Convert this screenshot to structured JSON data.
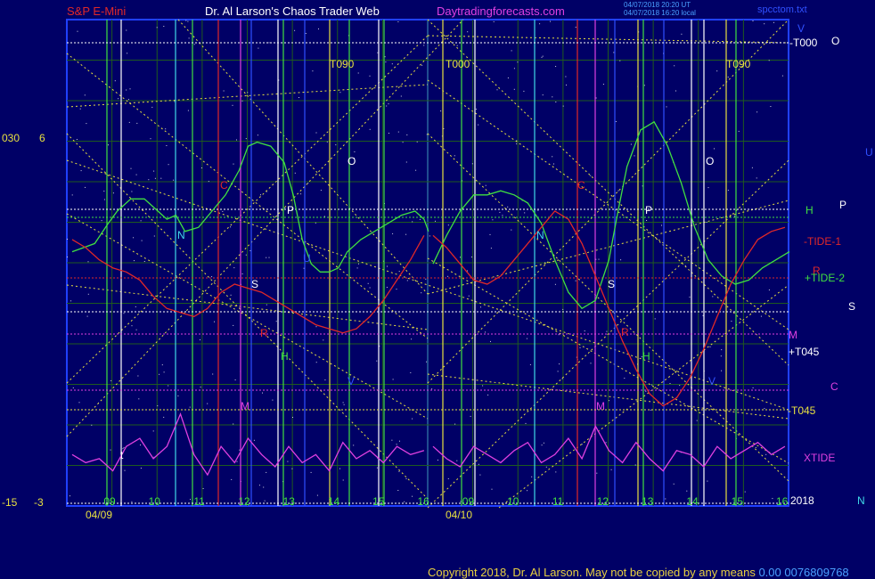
{
  "header": {
    "symbol": "S&P E-Mini",
    "site_title": "Dr. Al Larson's Chaos Trader Web",
    "url": "Daytradingforecasts.com",
    "timestamp1": "04/07/2018 20:20 UT",
    "timestamp2": "04/07/2018 16:20 local",
    "file": "spcctom.txt"
  },
  "footer": {
    "copyright": "Copyright 2018, Dr. Al Larson. May not be copied by any means",
    "tail": "0.00 0076809768"
  },
  "colors": {
    "background": "#000066",
    "grid_green": "#1f5a1f",
    "yellow": "#e8e040",
    "green": "#40e040",
    "red": "#e02828",
    "magenta": "#e040e0",
    "cyan": "#40d8e8",
    "white": "#ffffff",
    "blue": "#3050ff"
  },
  "chart_data": {
    "type": "line",
    "title": "S&P E-Mini",
    "y_left_labels": [
      {
        "label": "030",
        "value": 6
      },
      {
        "label": "6",
        "value": 6
      },
      {
        "label": "-15",
        "value": -3
      },
      {
        "label": "-3",
        "value": -3
      }
    ],
    "ylim": [
      -3,
      6
    ],
    "x_hour_ticks": [
      "09",
      "10",
      "11",
      "12",
      "13",
      "14",
      "15",
      "16",
      "09",
      "10",
      "11",
      "12",
      "13",
      "14",
      "15",
      "16"
    ],
    "x_dates": [
      "04/09",
      "04/10"
    ],
    "right_labels": [
      {
        "text": "V",
        "color": "#3050ff"
      },
      {
        "text": "-T000",
        "color": "#ffffff"
      },
      {
        "text": "O",
        "color": "#ffffff"
      },
      {
        "text": "U",
        "color": "#3050ff"
      },
      {
        "text": "H",
        "color": "#40e040"
      },
      {
        "text": "P",
        "color": "#ffffff"
      },
      {
        "text": "-TIDE-1",
        "color": "#e02828"
      },
      {
        "text": "R",
        "color": "#e02828"
      },
      {
        "text": "+TIDE-2",
        "color": "#40e040"
      },
      {
        "text": "S",
        "color": "#ffffff"
      },
      {
        "text": "M",
        "color": "#e040e0"
      },
      {
        "text": "+T045",
        "color": "#ffffff"
      },
      {
        "text": "C",
        "color": "#e040e0"
      },
      {
        "text": "-T045",
        "color": "#e8e040"
      },
      {
        "text": "XTIDE",
        "color": "#e040e0"
      },
      {
        "text": "2018",
        "color": "#ffffff"
      },
      {
        "text": "N",
        "color": "#40d8e8"
      }
    ],
    "marker_labels": [
      {
        "text": "T090",
        "color": "#e8e040"
      },
      {
        "text": "T000",
        "color": "#e8e040"
      },
      {
        "text": "T090",
        "color": "#e8e040"
      },
      {
        "text": "C",
        "color": "#e02828"
      },
      {
        "text": "N",
        "color": "#40d8e8"
      },
      {
        "text": "P",
        "color": "#ffffff"
      },
      {
        "text": "O",
        "color": "#ffffff"
      },
      {
        "text": "S",
        "color": "#ffffff"
      },
      {
        "text": "R",
        "color": "#e02828"
      },
      {
        "text": "H",
        "color": "#40e040"
      },
      {
        "text": "M",
        "color": "#e040e0"
      },
      {
        "text": "V",
        "color": "#3050ff"
      },
      {
        "text": "U",
        "color": "#3050ff"
      },
      {
        "text": "C",
        "color": "#e02828"
      },
      {
        "text": "N",
        "color": "#40d8e8"
      },
      {
        "text": "P",
        "color": "#ffffff"
      },
      {
        "text": "O",
        "color": "#ffffff"
      },
      {
        "text": "S",
        "color": "#ffffff"
      },
      {
        "text": "R",
        "color": "#e02828"
      },
      {
        "text": "H",
        "color": "#40e040"
      },
      {
        "text": "M",
        "color": "#e040e0"
      },
      {
        "text": "V",
        "color": "#3050ff"
      },
      {
        "text": "t",
        "color": "#ffffff"
      }
    ],
    "series": [
      {
        "name": "+TIDE-2",
        "color": "#40e040",
        "x": [
          9.0,
          9.5,
          9.8,
          10.0,
          10.3,
          10.6,
          10.9,
          11.1,
          11.3,
          11.5,
          11.8,
          12.1,
          12.4,
          12.7,
          12.9,
          13.1,
          13.4,
          13.7,
          13.9,
          14.1,
          14.3,
          14.5,
          14.7,
          14.9,
          15.1,
          15.4,
          15.7,
          16.0,
          16.3,
          16.6,
          16.8,
          16.9
        ],
        "values": [
          3.2,
          3.4,
          3.9,
          4.2,
          4.5,
          4.5,
          4.2,
          4.0,
          4.1,
          3.7,
          3.8,
          4.2,
          4.6,
          5.2,
          5.8,
          5.9,
          5.8,
          5.4,
          4.6,
          3.5,
          2.9,
          2.7,
          2.7,
          2.8,
          3.2,
          3.5,
          3.7,
          3.9,
          4.1,
          4.2,
          4.0,
          3.7
        ]
      },
      {
        "name": "+TIDE-2 (04/10)",
        "color": "#40e040",
        "x": [
          9.0,
          9.3,
          9.6,
          9.9,
          10.2,
          10.5,
          10.8,
          11.1,
          11.4,
          11.7,
          12.0,
          12.3,
          12.6,
          12.9,
          13.1,
          13.3,
          13.6,
          13.9,
          14.2,
          14.5,
          14.8,
          15.1,
          15.4,
          15.7,
          16.0,
          16.3,
          16.6,
          16.9
        ],
        "values": [
          2.9,
          3.6,
          4.2,
          4.6,
          4.6,
          4.7,
          4.6,
          4.4,
          3.9,
          3.0,
          2.2,
          1.8,
          2.0,
          3.0,
          4.2,
          5.3,
          6.2,
          6.4,
          5.8,
          4.9,
          3.8,
          3.0,
          2.6,
          2.4,
          2.5,
          2.8,
          3.0,
          3.2
        ]
      },
      {
        "name": "-TIDE-1",
        "color": "#e02828",
        "x": [
          9.0,
          9.3,
          9.6,
          9.9,
          10.2,
          10.5,
          10.8,
          11.1,
          11.4,
          11.7,
          12.0,
          12.3,
          12.6,
          12.9,
          13.2,
          13.5,
          13.8,
          14.1,
          14.4,
          14.7,
          15.0,
          15.3,
          15.6,
          15.9,
          16.2,
          16.5,
          16.8
        ],
        "values": [
          3.5,
          3.3,
          3.0,
          2.8,
          2.7,
          2.5,
          2.1,
          1.8,
          1.7,
          1.6,
          1.8,
          2.2,
          2.4,
          2.3,
          2.2,
          2.0,
          1.8,
          1.6,
          1.4,
          1.3,
          1.2,
          1.3,
          1.6,
          2.0,
          2.5,
          3.0,
          3.6
        ]
      },
      {
        "name": "-TIDE-1 (04/10)",
        "color": "#e02828",
        "x": [
          9.0,
          9.3,
          9.6,
          9.9,
          10.2,
          10.5,
          10.8,
          11.1,
          11.4,
          11.7,
          12.0,
          12.3,
          12.6,
          12.9,
          13.2,
          13.5,
          13.8,
          14.1,
          14.4,
          14.7,
          15.0,
          15.3,
          15.6,
          15.9,
          16.2,
          16.5,
          16.8
        ],
        "values": [
          3.6,
          3.3,
          2.9,
          2.5,
          2.4,
          2.6,
          3.0,
          3.4,
          3.8,
          4.2,
          4.0,
          3.4,
          2.6,
          1.8,
          1.0,
          0.3,
          -0.3,
          -0.6,
          -0.4,
          0.1,
          0.8,
          1.6,
          2.4,
          3.0,
          3.5,
          3.7,
          3.8
        ]
      },
      {
        "name": "XTIDE",
        "color": "#e040e0",
        "x": [
          9.0,
          9.3,
          9.6,
          9.9,
          10.2,
          10.5,
          10.8,
          11.1,
          11.4,
          11.7,
          12.0,
          12.3,
          12.6,
          12.9,
          13.2,
          13.5,
          13.8,
          14.1,
          14.4,
          14.7,
          15.0,
          15.3,
          15.6,
          15.9,
          16.2,
          16.5,
          16.8
        ],
        "values": [
          -1.8,
          -2.0,
          -1.9,
          -2.2,
          -1.6,
          -1.4,
          -1.9,
          -1.6,
          -0.8,
          -1.8,
          -2.3,
          -1.6,
          -2.0,
          -1.4,
          -1.8,
          -2.1,
          -1.6,
          -2.0,
          -1.8,
          -2.2,
          -1.5,
          -1.9,
          -1.7,
          -2.0,
          -1.6,
          -1.8,
          -1.7
        ]
      },
      {
        "name": "XTIDE (04/10)",
        "color": "#e040e0",
        "x": [
          9.0,
          9.3,
          9.6,
          9.9,
          10.2,
          10.5,
          10.8,
          11.1,
          11.4,
          11.7,
          12.0,
          12.3,
          12.6,
          12.9,
          13.2,
          13.5,
          13.8,
          14.1,
          14.4,
          14.7,
          15.0,
          15.3,
          15.6,
          15.9,
          16.2,
          16.5,
          16.8
        ],
        "values": [
          -1.6,
          -1.9,
          -2.1,
          -1.6,
          -1.8,
          -2.0,
          -1.7,
          -1.5,
          -2.0,
          -1.8,
          -1.4,
          -1.9,
          -1.1,
          -1.7,
          -2.0,
          -1.5,
          -1.9,
          -2.2,
          -1.7,
          -1.8,
          -2.1,
          -1.6,
          -1.9,
          -1.7,
          -1.5,
          -1.8,
          -1.6
        ]
      }
    ]
  }
}
